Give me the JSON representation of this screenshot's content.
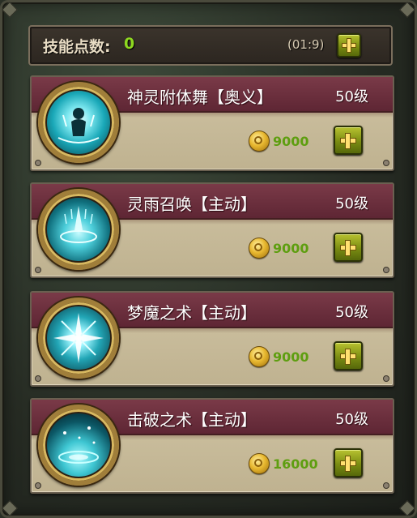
{
  "header": {
    "label": "技能点数:",
    "points": "0",
    "timer": "(01:9)"
  },
  "skills": [
    {
      "name": "神灵附体舞【奥义】",
      "level": "50级",
      "cost": "9000",
      "icon": "spirit-possession-icon"
    },
    {
      "name": "灵雨召唤【主动】",
      "level": "50级",
      "cost": "9000",
      "icon": "spirit-rain-icon"
    },
    {
      "name": "梦魔之术【主动】",
      "level": "50级",
      "cost": "9000",
      "icon": "nightmare-burst-icon"
    },
    {
      "name": "击破之术【主动】",
      "level": "50级",
      "cost": "16000",
      "icon": "break-ripple-icon"
    }
  ],
  "colors": {
    "accent_green": "#8ed820",
    "band_maroon": "#6e2e3c",
    "parchment": "#c8bb9b",
    "orb_cyan": "#4ed0dc"
  }
}
